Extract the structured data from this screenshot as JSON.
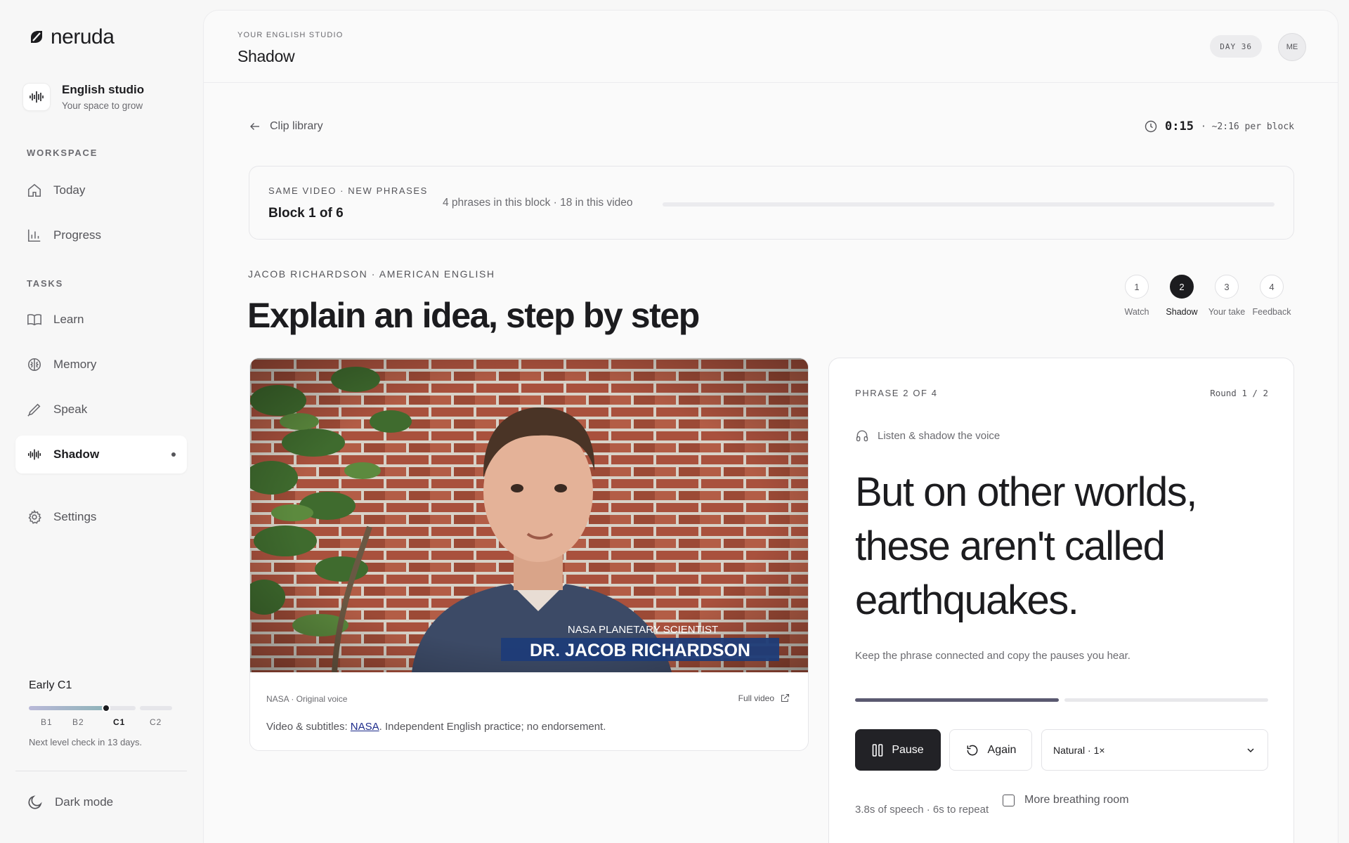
{
  "app": {
    "name": "neruda"
  },
  "studio": {
    "title": "English studio",
    "subtitle": "Your space to grow"
  },
  "sidebar": {
    "workspace_heading": "WORKSPACE",
    "tasks_heading": "TASKS",
    "workspace_items": [
      {
        "label": "Today",
        "icon": "home-icon"
      },
      {
        "label": "Progress",
        "icon": "chart-icon"
      }
    ],
    "task_items": [
      {
        "label": "Learn",
        "icon": "book-icon"
      },
      {
        "label": "Memory",
        "icon": "brain-icon"
      },
      {
        "label": "Speak",
        "icon": "pen-icon"
      },
      {
        "label": "Shadow",
        "icon": "waveform-icon",
        "active": true
      }
    ],
    "settings_label": "Settings",
    "level": {
      "title": "Early C1",
      "labels": [
        "B1",
        "B2",
        "C1",
        "C2"
      ],
      "current": "C1",
      "note": "Next level check in 13 days."
    },
    "dark_mode_label": "Dark mode"
  },
  "header": {
    "kicker": "YOUR ENGLISH STUDIO",
    "title": "Shadow",
    "day_badge": "DAY 36",
    "avatar": "ME"
  },
  "nav": {
    "back_label": "Clip library",
    "timer_value": "0:15",
    "timer_sub": "· ~2:16 per block"
  },
  "block": {
    "kicker": "SAME VIDEO · NEW PHRASES",
    "title": "Block 1 of 6",
    "info": "4 phrases in this block · 18 in this video",
    "progress": 0
  },
  "clip": {
    "speaker": "JACOB RICHARDSON · AMERICAN ENGLISH",
    "headline": "Explain an idea, step by step",
    "lower_third_role": "NASA PLANETARY SCIENTIST",
    "lower_third_name": "DR. JACOB RICHARDSON",
    "source_label": "NASA · Original voice",
    "full_video_label": "Full video",
    "credits_prefix": "Video & subtitles: ",
    "credits_link": "NASA",
    "credits_suffix": ". Independent English practice; no endorsement."
  },
  "steps": [
    {
      "num": "1",
      "label": "Watch"
    },
    {
      "num": "2",
      "label": "Shadow",
      "active": true
    },
    {
      "num": "3",
      "label": "Your take"
    },
    {
      "num": "4",
      "label": "Feedback"
    }
  ],
  "phrase": {
    "kicker": "PHRASE 2 OF 4",
    "round": "Round 1 / 2",
    "listen_label": "Listen & shadow the voice",
    "text": "But on other worlds, these aren't called earthquakes.",
    "hint": "Keep the phrase connected and copy the pauses you hear.",
    "pause_label": "Pause",
    "again_label": "Again",
    "speed_value": "Natural · 1×",
    "speech_note": "3.8s of speech · 6s to repeat",
    "breathing_label": "More breathing room",
    "breathing_checked": false
  }
}
